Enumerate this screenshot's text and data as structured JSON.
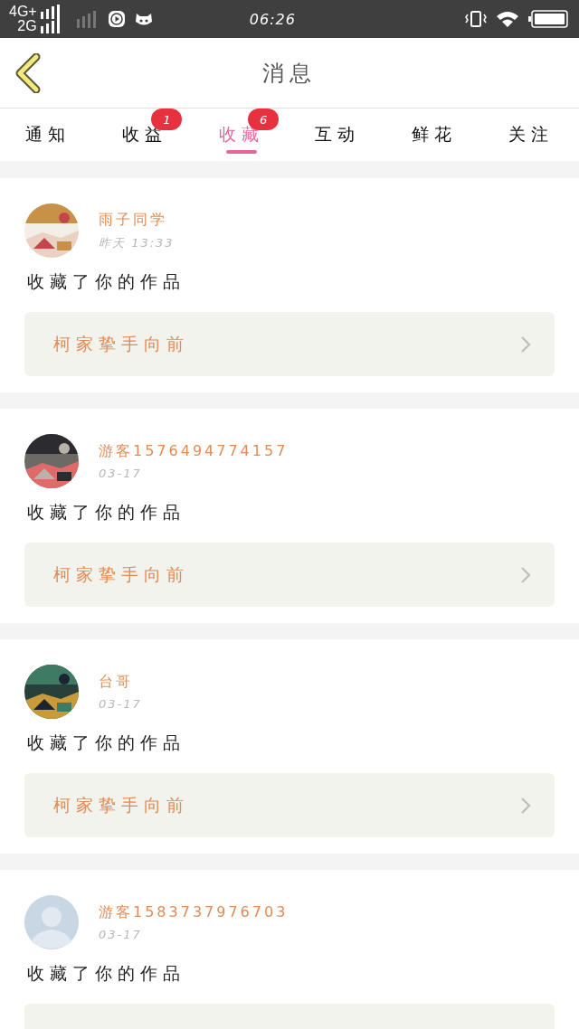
{
  "status_bar": {
    "network_1": "4G+",
    "network_2": "2G",
    "time": "06:26"
  },
  "header": {
    "title": "消息"
  },
  "tabs": [
    {
      "label": "通知",
      "selected": false
    },
    {
      "label": "收益",
      "selected": false,
      "badge": "1"
    },
    {
      "label": "收藏",
      "selected": true,
      "badge": "6"
    },
    {
      "label": "互动",
      "selected": false
    },
    {
      "label": "鲜花",
      "selected": false
    },
    {
      "label": "关注",
      "selected": false
    }
  ],
  "messages": [
    {
      "name": "雨子同学",
      "time": "昨天 13:33",
      "text": "收藏了你的作品",
      "work": "柯家挚手向前"
    },
    {
      "name": "游客1576494774157",
      "time": "03-17",
      "text": "收藏了你的作品",
      "work": "柯家挚手向前"
    },
    {
      "name": "台哥",
      "time": "03-17",
      "text": "收藏了你的作品",
      "work": "柯家挚手向前"
    },
    {
      "avatar": {
        "kind": "default"
      },
      "name": "游客1583737976703",
      "time": "03-17",
      "text": "收藏了你的作品"
    }
  ]
}
